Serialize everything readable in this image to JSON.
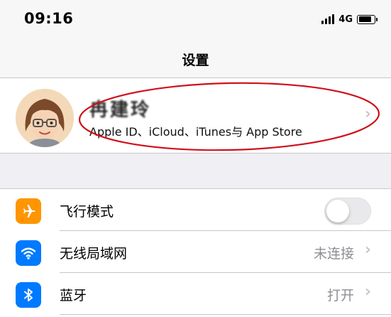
{
  "status_bar": {
    "time": "09:16",
    "network": "4G",
    "icons": [
      "signal-icon",
      "battery-icon"
    ]
  },
  "nav": {
    "title": "设置"
  },
  "profile": {
    "name": "冉建玲",
    "subtitle": "Apple ID、iCloud、iTunes与 App Store",
    "avatar_icon": "memoji-avatar-icon",
    "annotation_color": "#d0101a"
  },
  "settings": {
    "rows": [
      {
        "label": "飞行模式",
        "icon": "airplane-icon",
        "icon_bg": "#ff9500",
        "type": "toggle",
        "toggle_on": false
      },
      {
        "label": "无线局域网",
        "icon": "wifi-icon",
        "icon_bg": "#007aff",
        "type": "detail",
        "value": "未连接"
      },
      {
        "label": "蓝牙",
        "icon": "bluetooth-icon",
        "icon_bg": "#007aff",
        "type": "detail",
        "value": "打开"
      }
    ]
  },
  "colors": {
    "background": "#efeff4",
    "cell": "#ffffff",
    "secondary_text": "#8e8e93",
    "chevron": "#c7c7cc"
  }
}
